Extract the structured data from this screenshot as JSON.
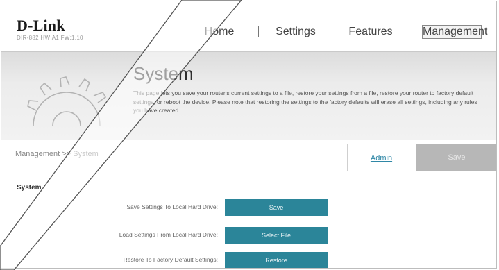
{
  "header": {
    "logo": "D-Link",
    "model": "DIR-882 HW:A1 FW:1.10"
  },
  "nav": {
    "items": [
      "Home",
      "Settings",
      "Features",
      "Management"
    ],
    "active": "Management"
  },
  "hero": {
    "title": "System",
    "description": "This page lets you save your router's current settings to a file, restore your settings from a file, restore your router to factory default settings, or reboot the device. Please note that restoring the settings to the factory defaults will erase all settings, including any rules you have created."
  },
  "crumbbar": {
    "breadcrumb": "Management >> System",
    "admin_link": "Admin",
    "save_label": "Save"
  },
  "main": {
    "section_title": "System",
    "rows": [
      {
        "label": "Save Settings To Local Hard Drive:",
        "button": "Save"
      },
      {
        "label": "Load Settings From Local Hard Drive:",
        "button": "Select File"
      },
      {
        "label": "Restore To Factory Default Settings:",
        "button": "Restore"
      }
    ]
  },
  "colors": {
    "accent": "#2b8599",
    "link": "#2f87a6",
    "save_disabled": "#b7b7b7"
  },
  "icons": [
    "gear-icon"
  ]
}
